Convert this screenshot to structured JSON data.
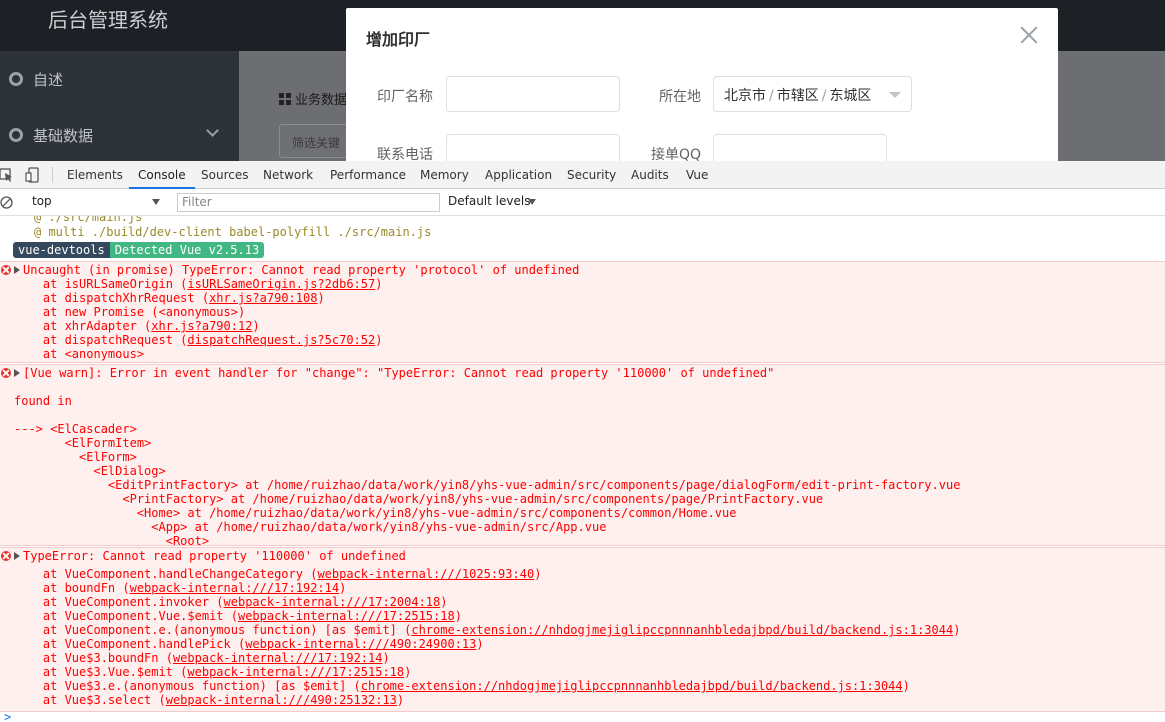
{
  "app": {
    "brand": "后台管理系统",
    "sidebar": [
      {
        "label": "自述"
      },
      {
        "label": "基础数据"
      }
    ],
    "content_title": "业务数据",
    "filter_placeholder": "筛选关键"
  },
  "dialog": {
    "title": "增加印厂",
    "fields": {
      "name_label": "印厂名称",
      "location_label": "所在地",
      "location_parts": [
        "北京市",
        "市辖区",
        "东城区"
      ],
      "location_sep": "/",
      "phone_label": "联系电话",
      "qq_label": "接单QQ"
    }
  },
  "devtools": {
    "tabs": [
      "Elements",
      "Console",
      "Sources",
      "Network",
      "Performance",
      "Memory",
      "Application",
      "Security",
      "Audits",
      "Vue"
    ],
    "active_tab": "Console",
    "context": "top",
    "filter_placeholder": "Filter",
    "levels": "Default levels",
    "console": {
      "pre_lines": [
        "@ ./src/main.js",
        "@ multi ./build/dev-client babel-polyfill ./src/main.js"
      ],
      "badge": [
        "vue-devtools",
        "Detected Vue v2.5.13"
      ],
      "error1": {
        "head": "Uncaught (in promise) TypeError: Cannot read property 'protocol' of undefined",
        "stack": [
          {
            "pre": "    at isURLSameOrigin (",
            "link": "isURLSameOrigin.js?2db6:57",
            "post": ")"
          },
          {
            "pre": "    at dispatchXhrRequest (",
            "link": "xhr.js?a790:108",
            "post": ")"
          },
          {
            "pre": "    at new Promise (<anonymous>)",
            "link": "",
            "post": ""
          },
          {
            "pre": "    at xhrAdapter (",
            "link": "xhr.js?a790:12",
            "post": ")"
          },
          {
            "pre": "    at dispatchRequest (",
            "link": "dispatchRequest.js?5c70:52",
            "post": ")"
          },
          {
            "pre": "    at <anonymous>",
            "link": "",
            "post": ""
          }
        ]
      },
      "error2": {
        "head": "[Vue warn]: Error in event handler for \"change\": \"TypeError: Cannot read property '110000' of undefined\"",
        "found": "found in",
        "tree": [
          "---> <ElCascader>",
          "       <ElFormItem>",
          "         <ElForm>",
          "           <ElDialog>",
          "             <EditPrintFactory> at /home/ruizhao/data/work/yin8/yhs-vue-admin/src/components/page/dialogForm/edit-print-factory.vue",
          "               <PrintFactory> at /home/ruizhao/data/work/yin8/yhs-vue-admin/src/components/page/PrintFactory.vue",
          "                 <Home> at /home/ruizhao/data/work/yin8/yhs-vue-admin/src/components/common/Home.vue",
          "                   <App> at /home/ruizhao/data/work/yin8/yhs-vue-admin/src/App.vue",
          "                     <Root>"
        ]
      },
      "error3": {
        "head": "TypeError: Cannot read property '110000' of undefined",
        "stack": [
          {
            "pre": "    at VueComponent.handleChangeCategory (",
            "link": "webpack-internal:///1025:93:40",
            "post": ")"
          },
          {
            "pre": "    at boundFn (",
            "link": "webpack-internal:///17:192:14",
            "post": ")"
          },
          {
            "pre": "    at VueComponent.invoker (",
            "link": "webpack-internal:///17:2004:18",
            "post": ")"
          },
          {
            "pre": "    at VueComponent.Vue.$emit (",
            "link": "webpack-internal:///17:2515:18",
            "post": ")"
          },
          {
            "pre": "    at VueComponent.e.(anonymous function) [as $emit] (",
            "link": "chrome-extension://nhdogjmejiglipccpnnnanhbledajbpd/build/backend.js:1:3044",
            "post": ")"
          },
          {
            "pre": "    at VueComponent.handlePick (",
            "link": "webpack-internal:///490:24900:13",
            "post": ")"
          },
          {
            "pre": "    at Vue$3.boundFn (",
            "link": "webpack-internal:///17:192:14",
            "post": ")"
          },
          {
            "pre": "    at Vue$3.Vue.$emit (",
            "link": "webpack-internal:///17:2515:18",
            "post": ")"
          },
          {
            "pre": "    at Vue$3.e.(anonymous function) [as $emit] (",
            "link": "chrome-extension://nhdogjmejiglipccpnnnanhbledajbpd/build/backend.js:1:3044",
            "post": ")"
          },
          {
            "pre": "    at Vue$3.select (",
            "link": "webpack-internal:///490:25132:13",
            "post": ")"
          }
        ]
      }
    }
  }
}
